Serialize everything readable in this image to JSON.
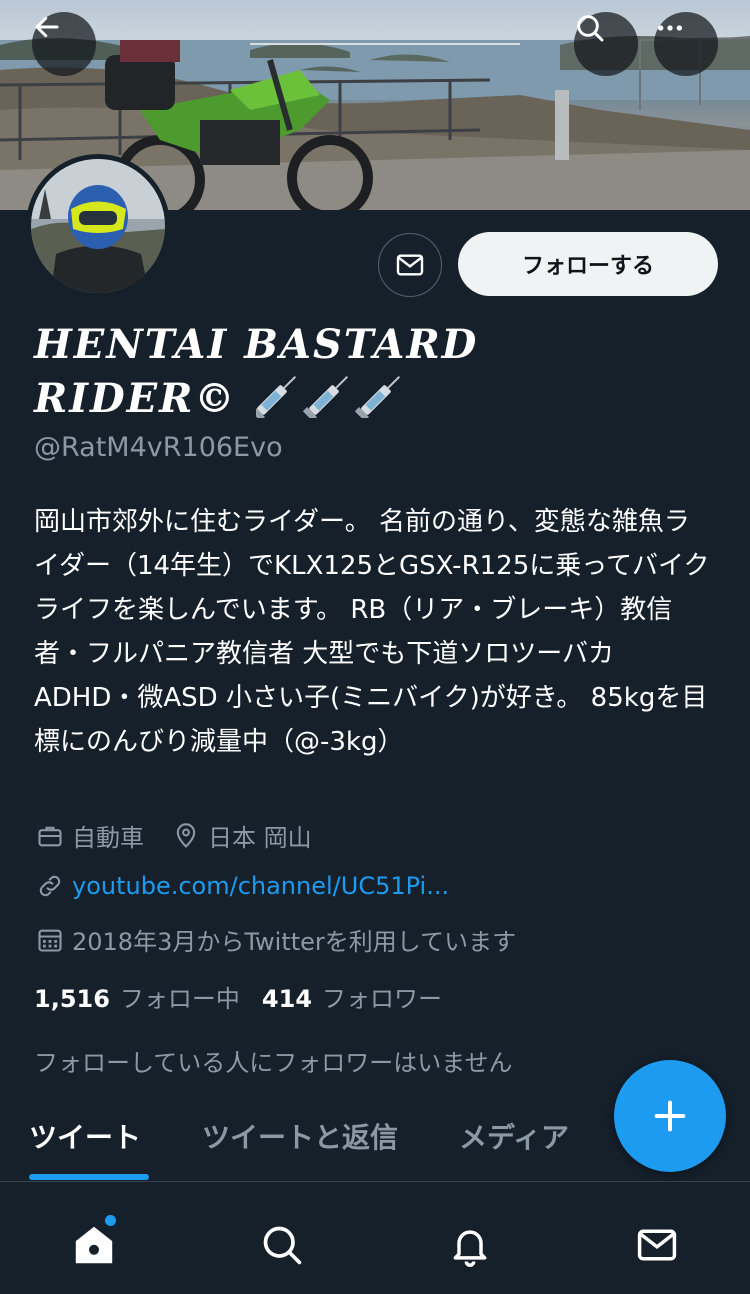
{
  "header": {
    "back_icon": "arrow-left-icon",
    "search_icon": "search-icon",
    "more_icon": "more-horizontal-icon"
  },
  "profile": {
    "display_name": "HENTAI BASTARD RIDER©",
    "display_name_emoji": "syringe-icon x3",
    "handle": "@RatM4vR106Evo",
    "follow_button": "フォローする",
    "bio": "岡山市郊外に住むライダー。 名前の通り、変態な雑魚ライダー（14年生）でKLX125とGSX-R125に乗ってバイクライフを楽しんでいます。 RB（リア・ブレーキ）教信者・フルパニア教信者 大型でも下道ソロツーバカ ADHD・微ASD 小さい子(ミニバイク)が好き。 85kgを目標にのんびり減量中（@-3kg）",
    "category": "自動車",
    "location": "日本 岡山",
    "link": "youtube.com/channel/UC51Pi...",
    "joined": "2018年3月からTwitterを利用しています",
    "following_count": "1,516",
    "following_label": "フォロー中",
    "followers_count": "414",
    "followers_label": "フォロワー",
    "mutual_note": "フォローしている人にフォロワーはいません"
  },
  "tabs": [
    {
      "label": "ツイート",
      "active": true
    },
    {
      "label": "ツイートと返信",
      "active": false
    },
    {
      "label": "メディア",
      "active": false
    }
  ],
  "fab": {
    "icon": "plus-icon"
  },
  "bottom_nav": [
    {
      "icon": "home-icon",
      "has_notification_dot": true
    },
    {
      "icon": "search-icon"
    },
    {
      "icon": "bell-icon"
    },
    {
      "icon": "mail-icon"
    }
  ],
  "colors": {
    "background": "#15202b",
    "accent": "#1d9bf0",
    "secondary_text": "#8b98a5",
    "follow_button_bg": "#eff3f4"
  }
}
